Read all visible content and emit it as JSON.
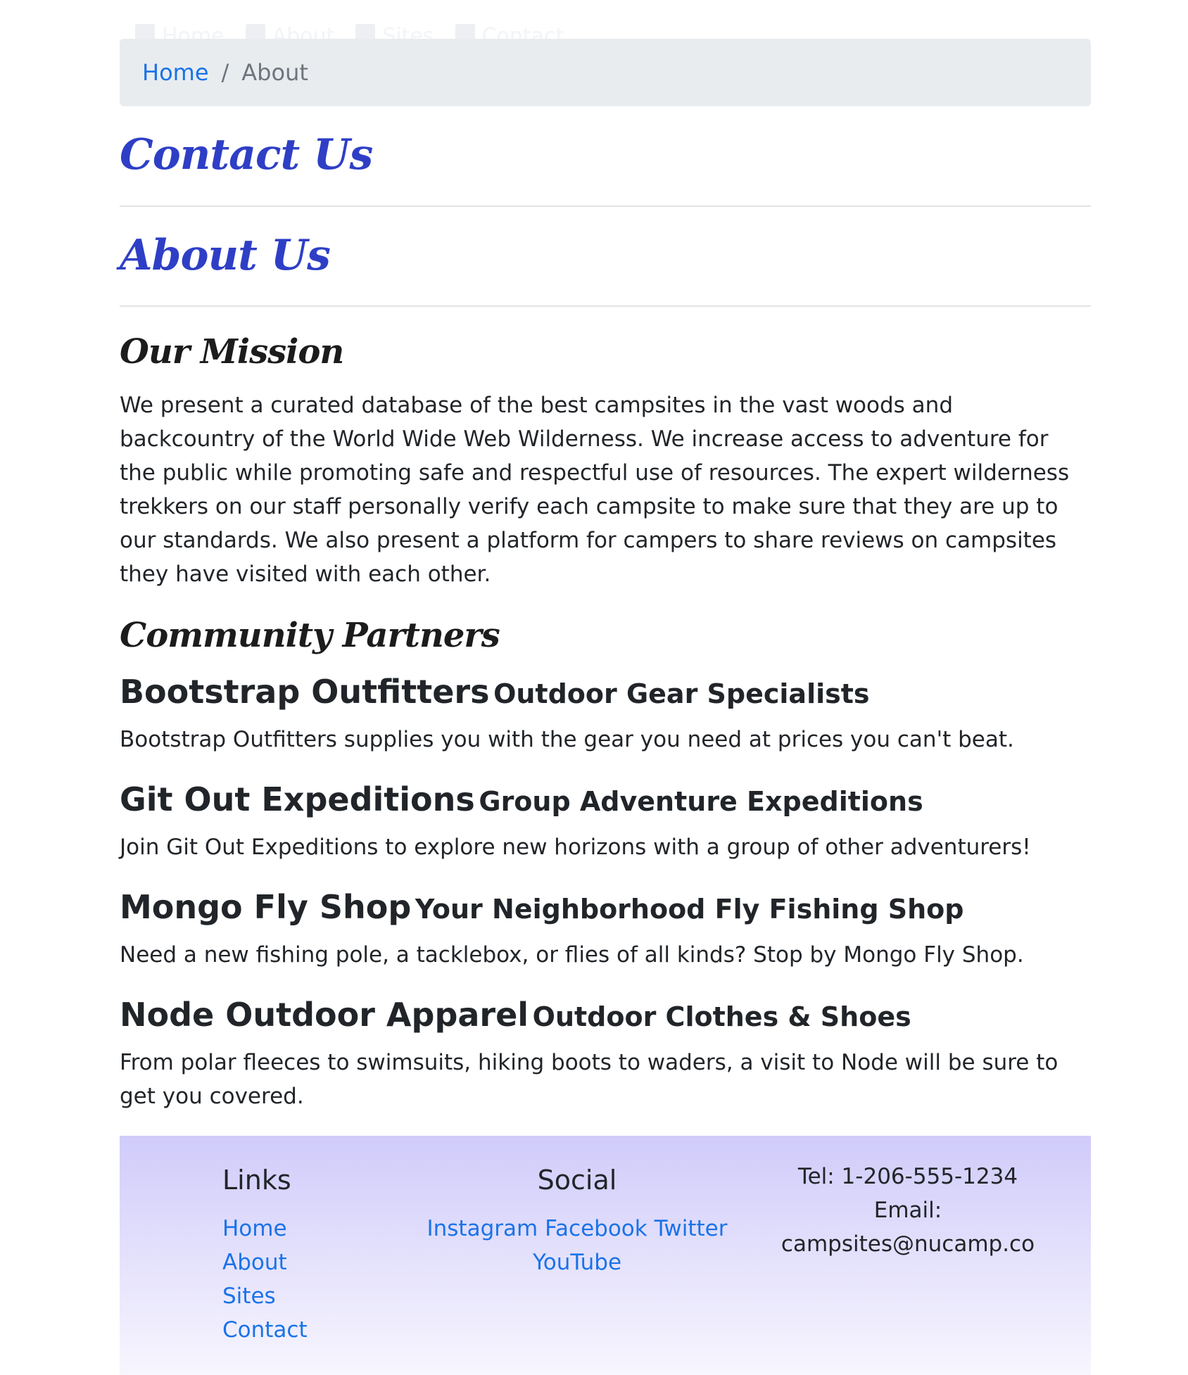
{
  "navbar": {
    "items": [
      "Home",
      "About",
      "Sites",
      "Contact"
    ]
  },
  "breadcrumb": {
    "home": "Home",
    "separator": "/",
    "current": "About"
  },
  "headings": {
    "contact": "Contact Us",
    "about": "About Us",
    "mission": "Our Mission",
    "partners": "Community Partners"
  },
  "mission_text": "We present a curated database of the best campsites in the vast woods and backcountry of the World Wide Web Wilderness. We increase access to adventure for the public while promoting safe and respectful use of resources. The expert wilderness trekkers on our staff personally verify each campsite to make sure that they are up to our standards. We also present a platform for campers to share reviews on campsites they have visited with each other.",
  "partners": [
    {
      "name": "Bootstrap Outfitters",
      "tagline": "Outdoor Gear Specialists",
      "description": "Bootstrap Outfitters supplies you with the gear you need at prices you can't beat."
    },
    {
      "name": "Git Out Expeditions",
      "tagline": "Group Adventure Expeditions",
      "description": "Join Git Out Expeditions to explore new horizons with a group of other adventurers!"
    },
    {
      "name": "Mongo Fly Shop",
      "tagline": "Your Neighborhood Fly Fishing Shop",
      "description": "Need a new fishing pole, a tacklebox, or flies of all kinds? Stop by Mongo Fly Shop."
    },
    {
      "name": "Node Outdoor Apparel",
      "tagline": "Outdoor Clothes & Shoes",
      "description": "From polar fleeces to swimsuits, hiking boots to waders, a visit to Node will be sure to get you covered."
    }
  ],
  "footer": {
    "links_title": "Links",
    "links": [
      "Home",
      "About",
      "Sites",
      "Contact"
    ],
    "social_title": "Social",
    "social": [
      "Instagram",
      "Facebook",
      "Twitter",
      "YouTube"
    ],
    "tel": "Tel: 1-206-555-1234",
    "email_label": "Email:",
    "email": "campsites@nucamp.co"
  },
  "colors": {
    "link": "#1a73e8",
    "script_title": "#2e3fc6",
    "footer_top": "#d0cbfa"
  }
}
